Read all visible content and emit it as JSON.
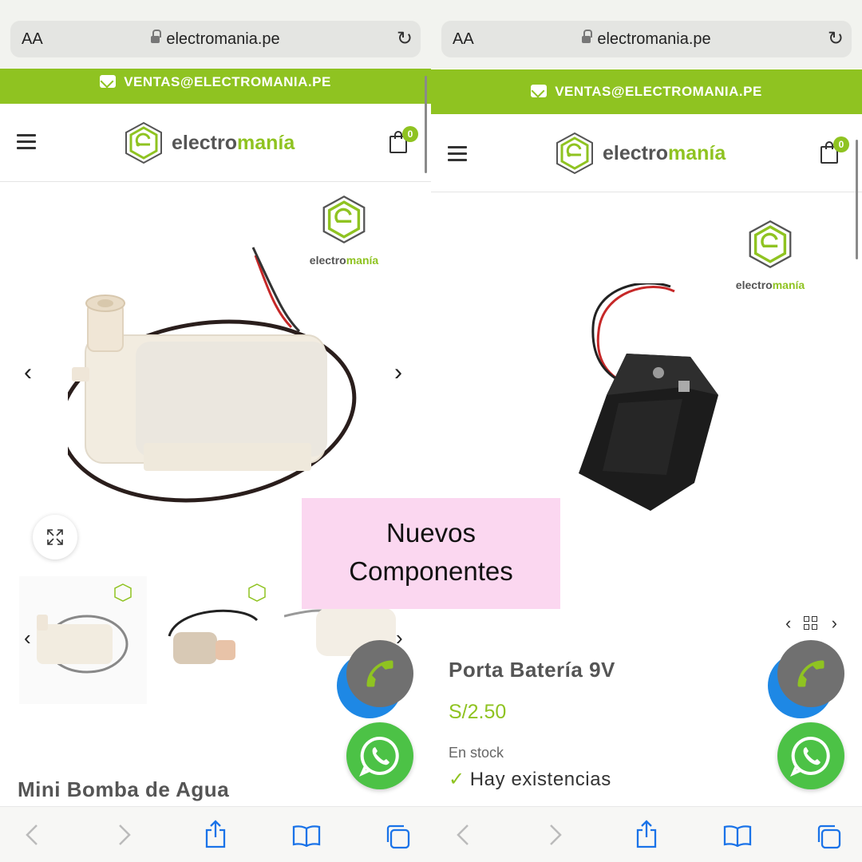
{
  "browser": {
    "text_size_button": "AA",
    "address": "electromania.pe"
  },
  "banner": {
    "email": "VENTAS@ELECTROMANIA.PE"
  },
  "brand": {
    "word_start": "electro",
    "word_end": "manía"
  },
  "watermark": {
    "word_start": "electro",
    "word_end": "manía"
  },
  "cart": {
    "count": "0"
  },
  "left_product": {
    "title": "Mini Bomba de Agua"
  },
  "right_product": {
    "title": "Porta Batería 9V",
    "price": "S/2.50",
    "stock_label": "En stock",
    "stock_value": "Hay existencias"
  },
  "overlay": {
    "line1": "Nuevos",
    "line2": "Componentes"
  },
  "colors": {
    "brand_green": "#8fc321",
    "whatsapp_green": "#4cc246",
    "call_gray": "#707070",
    "overlay_pink": "#fbd7f0"
  },
  "icons": [
    "lock-icon",
    "reload-icon",
    "mail-icon",
    "hamburger-icon",
    "cart-icon",
    "chevron-left-icon",
    "chevron-right-icon",
    "expand-icon",
    "grid-icon",
    "phone-icon",
    "whatsapp-icon",
    "back-icon",
    "forward-icon",
    "share-icon",
    "bookmarks-icon",
    "tabs-icon"
  ]
}
